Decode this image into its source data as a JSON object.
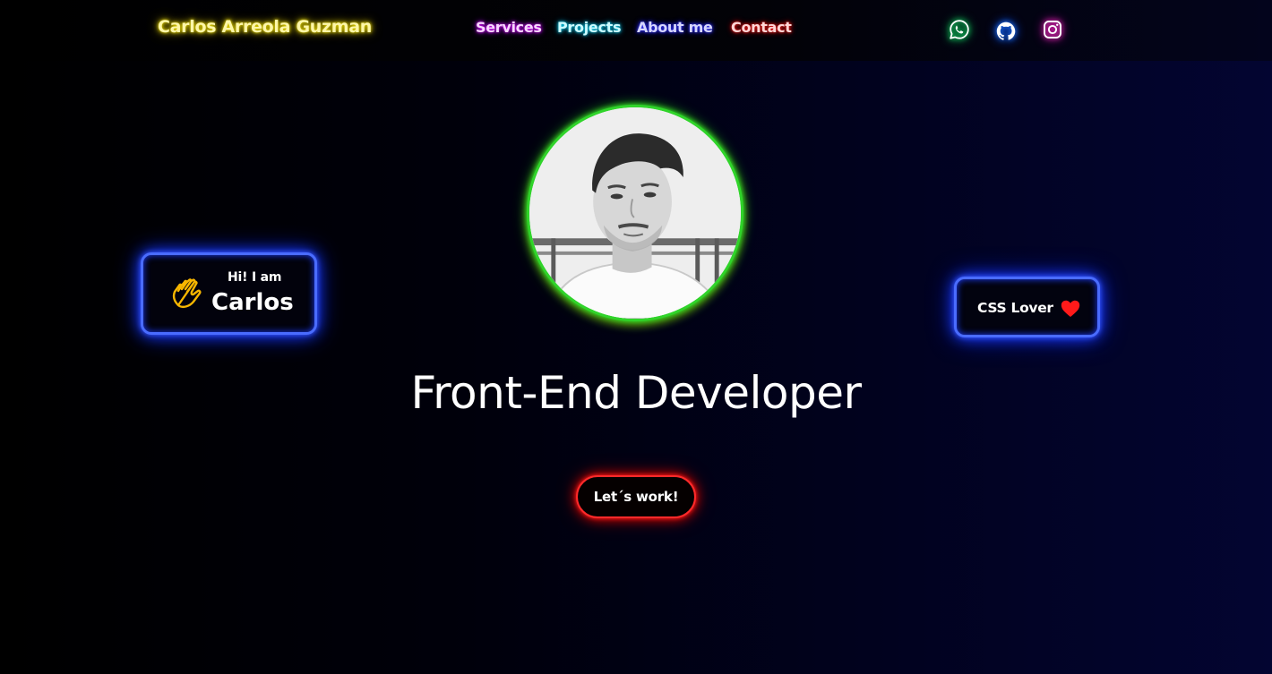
{
  "header": {
    "brand": "Carlos Arreola Guzman",
    "nav": {
      "services": "Services",
      "projects": "Projects",
      "about": "About me",
      "contact": "Contact"
    },
    "social_icons": [
      "whatsapp-icon",
      "github-icon",
      "instagram-icon"
    ]
  },
  "hero": {
    "avatar_icon": "profile-photo",
    "greeting_card": {
      "small_text": "Hi! I am",
      "name": "Carlos",
      "icon": "waving-hand-icon"
    },
    "side_card": {
      "label": "CSS Lover",
      "icon": "heart-icon"
    },
    "role_title": "Front-End Developer",
    "cta_label": "Let´s work!"
  },
  "colors": {
    "brand_glow": "#f1e100",
    "services_glow": "#e000ff",
    "projects_glow": "#10e0ff",
    "about_glow": "#3a3aff",
    "contact_glow": "#ff2020",
    "card_border": "#4a6cff",
    "avatar_border": "#30d42a",
    "cta_border": "#ff2a2a",
    "heart": "#ff1a1a",
    "wave_hand": "#f7b600"
  }
}
